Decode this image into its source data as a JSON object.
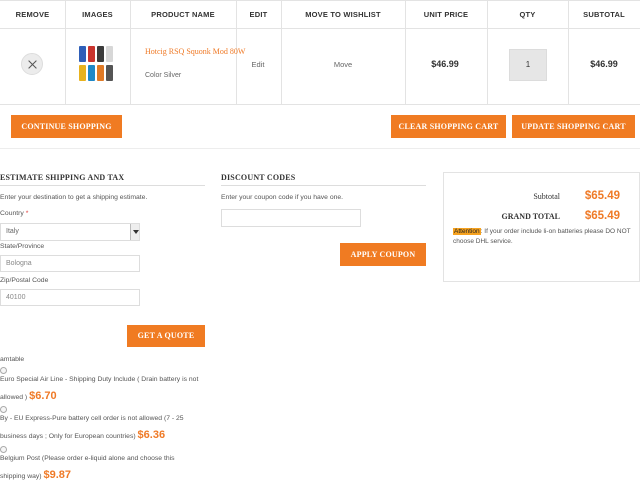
{
  "table": {
    "headers": {
      "remove": "REMOVE",
      "images": "IMAGES",
      "product_name": "PRODUCT NAME",
      "edit": "EDIT",
      "move_to_wishlist": "MOVE TO WISHLIST",
      "unit_price": "UNIT PRICE",
      "qty": "QTY",
      "subtotal": "SUBTOTAL"
    },
    "row": {
      "product_name": "Hotcig RSQ Squonk Mod 80W",
      "option": "Color Silver",
      "edit": "Edit",
      "move": "Move",
      "unit_price": "$46.99",
      "qty": "1",
      "subtotal": "$46.99",
      "remove_icon": "close-icon"
    }
  },
  "actions": {
    "continue": "CONTINUE SHOPPING",
    "clear": "CLEAR SHOPPING CART",
    "update": "UPDATE SHOPPING CART"
  },
  "shipping": {
    "title": "ESTIMATE SHIPPING AND TAX",
    "intro": "Enter your destination to get a shipping estimate.",
    "country_label": "Country",
    "required_mark": "*",
    "country_value": "Italy",
    "state_label": "State/Province",
    "state_value": "Bologna",
    "zip_label": "Zip/Postal Code",
    "zip_value": "40100",
    "quote_button": "GET A QUOTE",
    "method_group": "amtable",
    "methods": [
      {
        "line1": "Euro Special Air Line - Shipping Duty Include ( Drain battery is not",
        "line2": "allowed )",
        "price": "$6.70"
      },
      {
        "line1": "By - EU Express-Pure battery cell order is not allowed (7 - 25",
        "line2": "business days ; Only for European countries)",
        "price": "$6.36"
      },
      {
        "line1": "Belgium Post (Please order e-liquid alone and choose this",
        "line2": "shipping way)",
        "price": "$9.87"
      }
    ]
  },
  "discount": {
    "title": "DISCOUNT CODES",
    "intro": "Enter your coupon code if you have one.",
    "input_value": "",
    "button": "APPLY COUPON"
  },
  "totals": {
    "subtotal_label": "Subtotal",
    "subtotal_value": "$65.49",
    "grand_label": "GRAND TOTAL",
    "grand_value": "$65.49",
    "attention_label": "Attention",
    "attention_text": ": If your order include li-on batteries please DO NOT choose DHL service."
  },
  "colors": {
    "accent": "#f07b22",
    "price": "#ef7a27",
    "highlight": "#f6a21f"
  }
}
